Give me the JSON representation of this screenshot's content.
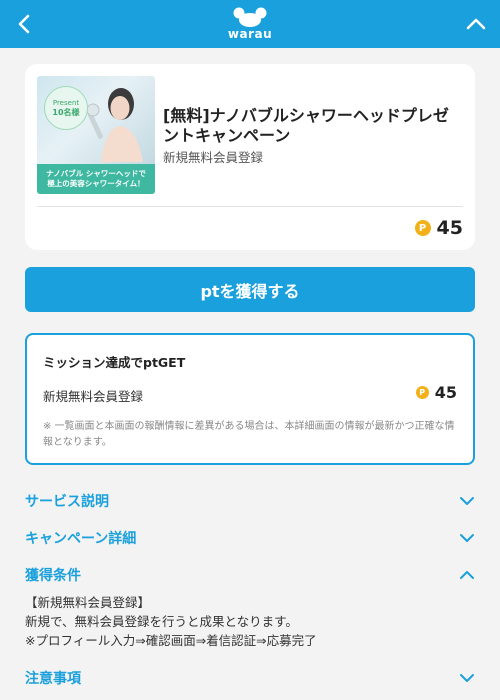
{
  "header": {
    "logo_text": "warau",
    "back_icon": "chevron-left-icon",
    "up_icon": "chevron-up-icon",
    "background": "#1aa0dc"
  },
  "offer": {
    "thumbnail": {
      "badge_line1": "Present",
      "badge_line2": "10名様",
      "banner_line1": "ナノバブル シャワーヘッドで",
      "banner_line2": "極上の美容シャワータイム！"
    },
    "title": "[無料]ナノバブルシャワーヘッドプレゼントキャンペーン",
    "subtitle": "新規無料会員登録",
    "points": "45"
  },
  "cta": {
    "label": "ptを獲得する"
  },
  "mission": {
    "title": "ミッション達成でptGET",
    "item_label": "新規無料会員登録",
    "item_points": "45",
    "note": "※ 一覧画面と本画面の報酬情報に差異がある場合は、本詳細画面の情報が最新かつ正確な情報となります。"
  },
  "sections": [
    {
      "label": "サービス説明",
      "expanded": false
    },
    {
      "label": "キャンペーン詳細",
      "expanded": false
    },
    {
      "label": "獲得条件",
      "expanded": true
    },
    {
      "label": "注意事項",
      "expanded": false
    }
  ],
  "conditions": {
    "line1": "【新規無料会員登録】",
    "line2": "新規で、無料会員登録を行うと成果となります。",
    "line3": "※プロフィール入力⇒確認画面⇒着信認証⇒応募完了"
  },
  "colors": {
    "accent": "#1aa0dc",
    "coin": "#f2b11a",
    "background": "#f3f3f3"
  }
}
